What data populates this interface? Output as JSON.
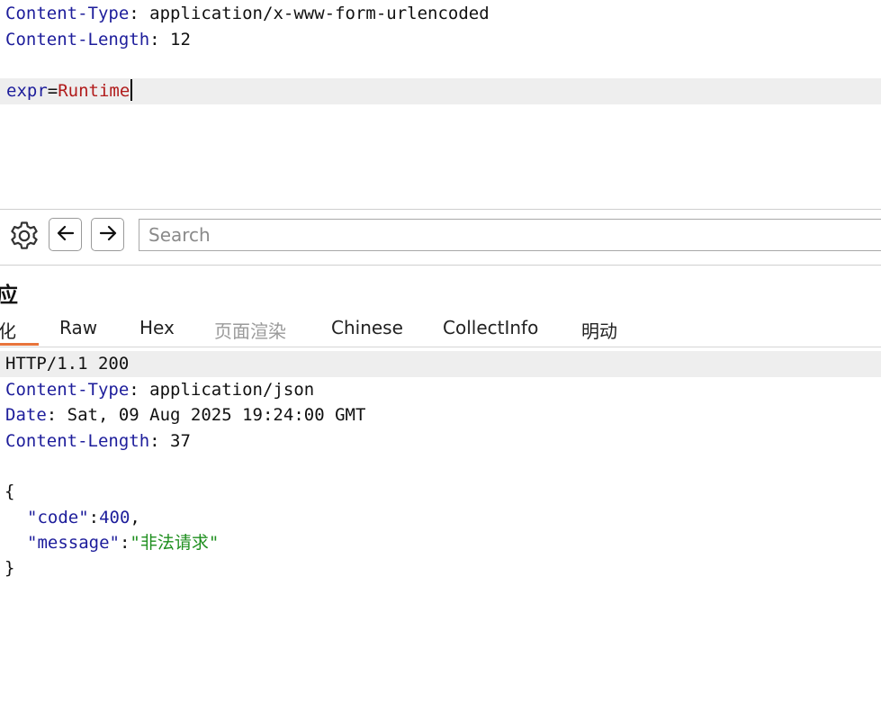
{
  "request": {
    "headers": [
      {
        "name": "Content-Type",
        "value": "application/x-www-form-urlencoded"
      },
      {
        "name": "Content-Length",
        "value": "12"
      }
    ],
    "body": {
      "param_name": "expr",
      "equals": "=",
      "param_value": "Runtime"
    }
  },
  "toolbar": {
    "icons": {
      "settings": "gear-icon",
      "back": "arrow-left-icon",
      "forward": "arrow-right-icon"
    },
    "search_placeholder": "Search"
  },
  "response_panel": {
    "title": "应",
    "tabs": [
      {
        "label": "化",
        "active": true
      },
      {
        "label": "Raw"
      },
      {
        "label": "Hex"
      },
      {
        "label": "页面渲染",
        "disabled": true
      },
      {
        "label": "Chinese"
      },
      {
        "label": "CollectInfo"
      },
      {
        "label": "明动"
      }
    ],
    "status_line": "HTTP/1.1 200",
    "headers": [
      {
        "name": "Content-Type",
        "value": "application/json"
      },
      {
        "name": "Date",
        "value": "Sat, 09 Aug 2025 19:24:00 GMT"
      },
      {
        "name": "Content-Length",
        "value": "37"
      }
    ],
    "json": {
      "open": "{",
      "close": "}",
      "code_key": "\"code\"",
      "code_value": "400",
      "message_key": "\"message\"",
      "message_value": "\"非法请求\""
    }
  },
  "colors": {
    "accent_underline": "#e8743b",
    "key": "#1d1d9b",
    "string": "#1f8f1f",
    "param_value": "#b11b1b"
  }
}
